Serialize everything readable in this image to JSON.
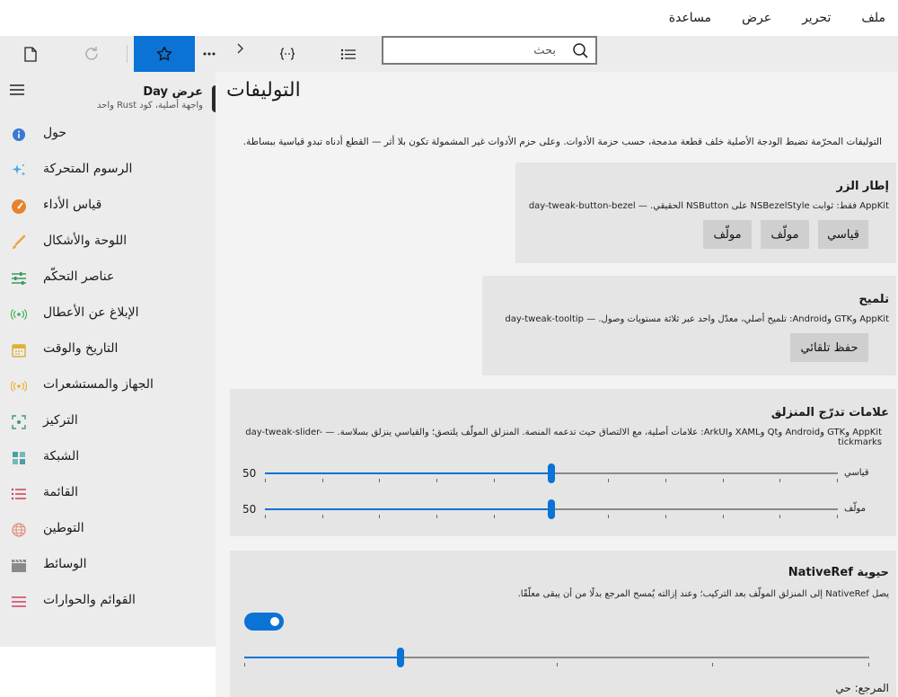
{
  "menu": {
    "items": [
      "ملف",
      "تحرير",
      "عرض",
      "مساعدة"
    ]
  },
  "search": {
    "placeholder": "بحث"
  },
  "sidebar": {
    "app_title": "عرض Day",
    "app_subtitle": "واجهة أصلية، كود Rust واحد",
    "items": [
      {
        "label": "حول",
        "icon": "info-icon",
        "color": "#3a78d4"
      },
      {
        "label": "الرسوم المتحركة",
        "icon": "sparkle-icon",
        "color": "#48a8e0"
      },
      {
        "label": "قياس الأداء",
        "icon": "gauge-icon",
        "color": "#e8822e"
      },
      {
        "label": "اللوحة والأشكال",
        "icon": "brush-icon",
        "color": "#f0a040"
      },
      {
        "label": "عناصر التحكّم",
        "icon": "sliders-icon",
        "color": "#3a9a5a"
      },
      {
        "label": "الإبلاغ عن الأعطال",
        "icon": "broadcast-icon",
        "color": "#3ab050"
      },
      {
        "label": "التاريخ والوقت",
        "icon": "calendar-icon",
        "color": "#e0b030"
      },
      {
        "label": "الجهاز والمستشعرات",
        "icon": "sensor-icon",
        "color": "#e8b030"
      },
      {
        "label": "التركيز",
        "icon": "focus-icon",
        "color": "#3a9a7a"
      },
      {
        "label": "الشبكة",
        "icon": "grid-icon",
        "color": "#4aa0a0"
      },
      {
        "label": "القائمة",
        "icon": "list-icon",
        "color": "#d04050"
      },
      {
        "label": "التوطين",
        "icon": "globe-icon",
        "color": "#e09080"
      },
      {
        "label": "الوسائط",
        "icon": "clapper-icon",
        "color": "#8a8a8a"
      },
      {
        "label": "القوائم والحوارات",
        "icon": "menu-lines-icon",
        "color": "#d04060"
      }
    ]
  },
  "main": {
    "title": "التوليفات",
    "intro": "التوليفات المحرّمة تضبط الودجة الأصلية خلف قطعة مدمجة، حسب حزمة الأدوات. وعلى حزم الأدوات غير المشمولة تكون بلا أثر — القطع أدناه تبدو قياسية ببساطة.",
    "bezel": {
      "title": "إطار الزر",
      "desc": "AppKit فقط: ثوابت NSBezelStyle على NSButton الحقيقي. — day-tweak-button-bezel",
      "buttons": [
        "قياسي",
        "مولّف",
        "مولّف"
      ]
    },
    "tooltip": {
      "title": "تلميح",
      "desc": "AppKit وGTK وAndroid: تلميح أصلي، معدّل واحد عبر ثلاثة مستويات وصول. — day-tweak-tooltip",
      "button": "حفظ تلقائي"
    },
    "slider": {
      "title": "علامات تدرّج المنزلق",
      "desc": "AppKit وGTK وAndroid وQt وXAML وArkUI: علامات أصلية، مع الالتصاق حيث تدعمه المنصة. المنزلق المولّف يلتصق؛ والقياسي ينزلق بسلاسة. — day-tweak-slider-tickmarks",
      "rows": [
        {
          "label": "قياسي",
          "value": 50,
          "display": "50"
        },
        {
          "label": "مولّف",
          "value": 50,
          "display": "50"
        }
      ],
      "min": 0,
      "max": 100,
      "tick_count": 11
    },
    "nativeref": {
      "title": "حيوية NativeRef",
      "desc": "يصل NativeRef إلى المنزلق المولّف بعد التركيب؛ وعند إزالته يُمسح المرجع بدلًا من أن يبقى معلّقًا.",
      "toggle_on": true,
      "slider_value": 25,
      "tick_count": 5,
      "ref_label": "المرجع: حي"
    }
  },
  "colors": {
    "accent": "#0b72d6",
    "sidebar_bg": "#ececec",
    "card_bg": "#e5e5e5",
    "button_bg": "#cfcfcf"
  }
}
